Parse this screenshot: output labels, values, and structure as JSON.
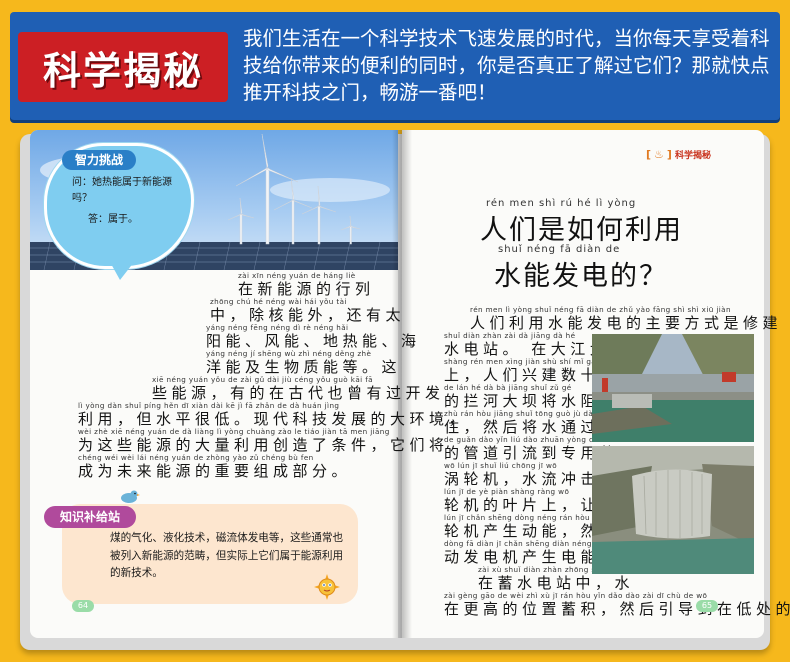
{
  "banner": {
    "label": "科学揭秘",
    "intro_lines": [
      "我们生活在一个科学技术飞速发展的时代，当你每天享受着科",
      "技给你带来的便利的同时，你是否真正了解过它们？那就快点",
      "推开科技之门，畅游一番吧！"
    ]
  },
  "left_page": {
    "challenge": {
      "tag": "智力挑战",
      "question": "问：她热能属于新能源吗？",
      "answer": "答：属于。"
    },
    "body_lines": [
      {
        "py": "zài xīn néng yuán de háng liè",
        "hz": "在新能源的行列"
      },
      {
        "py": "zhōng  chú hé néng wài  hái yǒu tài",
        "hz": "中，除核能外，还有太"
      },
      {
        "py": "yáng néng fēng néng dì rè néng hǎi",
        "hz": "阳能、风能、地热能、海"
      },
      {
        "py": "yáng néng jí shēng wù zhì néng děng  zhè",
        "hz": "洋能及生物质能等。这"
      },
      {
        "py": "xiē néng yuán  yǒu de zài gǔ dài jiù céng yǒu guò kāi fā",
        "hz": "些能源，有的在古代也曾有过开发"
      },
      {
        "py": "lì yòng  dàn shuǐ píng hěn dī  xiàn dài kē jì fā zhǎn de dà huán jìng",
        "hz": "利用，但水平很低。现代科技发展的大环境，"
      },
      {
        "py": "wèi zhè xiē néng yuán de dà liàng lì yòng chuàng zào le tiáo jiàn  tā men jiāng",
        "hz": "为这些能源的大量利用创造了条件，它们将"
      },
      {
        "py": "chéng wéi wèi lái néng yuán de zhòng yào zǔ chéng bù fen",
        "hz": "成为未来能源的重要组成部分。"
      }
    ],
    "knowledge": {
      "tag": "知识补给站",
      "text": "煤的气化、液化技术，磁流体发电等，这些通常也被列入新能源的范畴，但实际上它们属于能源利用的新技术。"
    },
    "page_number": "64"
  },
  "right_page": {
    "section_label": "科学揭秘",
    "title": {
      "line1_py": "rén men shì rú hé lì yòng",
      "line1": "人们是如何利用",
      "line2_py": "shuǐ néng fā diàn de",
      "line2": "水能发电的？"
    },
    "body_lines": [
      {
        "py": "rén men lì yòng shuǐ néng fā diàn de zhǔ yào fāng shì shì xiū jiàn",
        "hz": "人们利用水能发电的主要方式是修建"
      },
      {
        "py": "shuǐ diàn zhàn   zài dà jiāng dà hé",
        "hz": "水电站。 在大江大河"
      },
      {
        "py": "shàng  rén men xìng jiàn shù shí mǐ gāo",
        "hz": "上，人们兴建数十米高"
      },
      {
        "py": "de lán hé dà bà jiāng shuǐ zǔ gé",
        "hz": "的拦河大坝将水阻隔"
      },
      {
        "py": "zhù  rán hòu jiāng shuǐ tōng guò jù dà",
        "hz": "住，然后将水通过巨大"
      },
      {
        "py": "de guǎn dào yǐn liú dào zhuān yòng de",
        "hz": "的管道引流到专用的"
      },
      {
        "py": "wō lún jī  shuǐ liú chōng jī wō",
        "hz": "涡轮机，水流冲击涡"
      },
      {
        "py": "lún jī de yè piàn shàng  ràng wō",
        "hz": "轮机的叶片上，让涡"
      },
      {
        "py": "lún jī chǎn shēng dòng néng  rán hòu tuī",
        "hz": "轮机产生动能，然后推"
      },
      {
        "py": "dòng fā diàn jī chǎn shēng diàn néng",
        "hz": "动发电机产生电能。"
      },
      {
        "py": "zài xù shuǐ diàn zhàn zhōng  shuǐ",
        "hz": "在蓄水电站中，水"
      },
      {
        "py": "zài gèng gāo de wèi zhì xù jī  rán hòu yǐn dǎo dào zài dī chù de wō",
        "hz": "在更高的位置蓄积，然后引导到在低处的涡"
      }
    ],
    "page_number": "65"
  },
  "colors": {
    "background": "#f6b81c",
    "banner": "#1f5fb4",
    "banner_label": "#cc1f24",
    "challenge_bubble": "#7fcdf0",
    "knowledge_box": "#fde6cf",
    "knowledge_tag": "#b04a9c"
  }
}
